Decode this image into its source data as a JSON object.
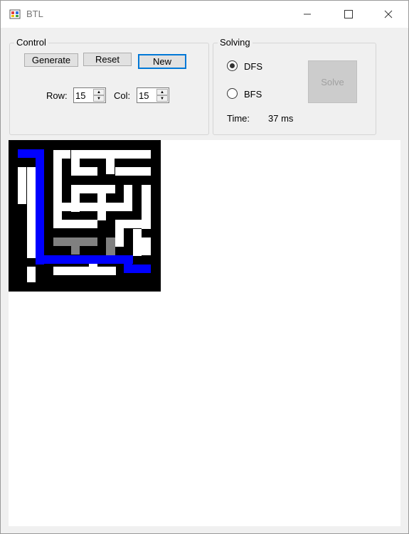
{
  "window": {
    "title": "BTL",
    "minimize_icon": "minimize-icon",
    "maximize_icon": "maximize-icon",
    "close_icon": "close-icon"
  },
  "control": {
    "group_title": "Control",
    "generate_label": "Generate",
    "reset_label": "Reset",
    "new_label": "New",
    "row_label": "Row:",
    "row_value": "15",
    "col_label": "Col:",
    "col_value": "15"
  },
  "solving": {
    "group_title": "Solving",
    "dfs_label": "DFS",
    "bfs_label": "BFS",
    "selected": "DFS",
    "solve_label": "Solve",
    "time_label": "Time:",
    "time_value": "37 ms"
  },
  "maze": {
    "rows": 15,
    "cols": 15,
    "colors": {
      "wall": "#000000",
      "open": "#ffffff",
      "path": "#0000ff",
      "visited": "#808080"
    }
  }
}
